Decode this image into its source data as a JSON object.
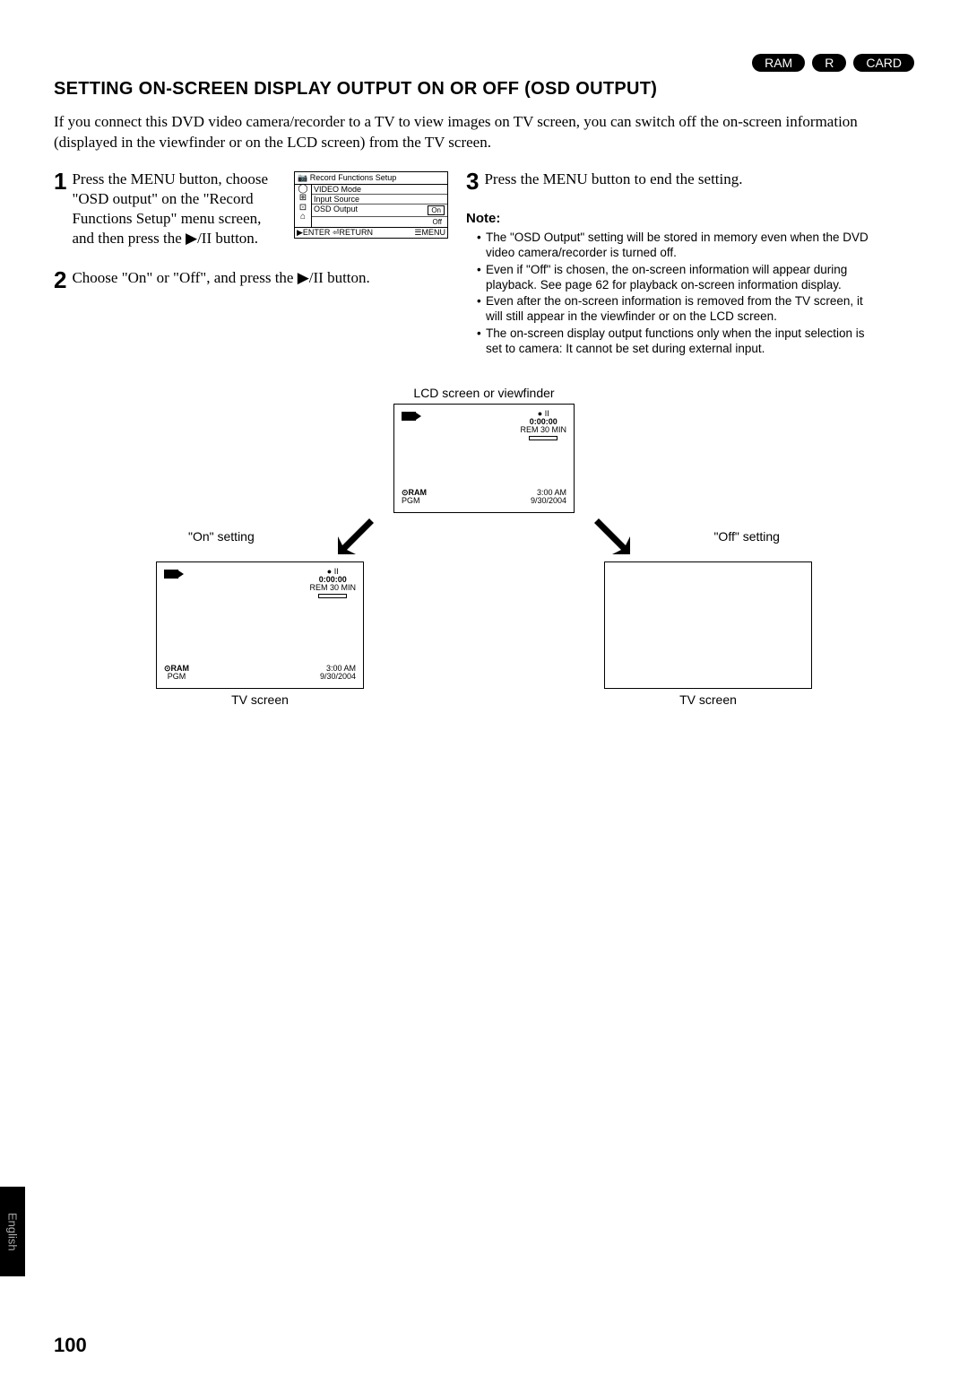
{
  "badges": [
    "RAM",
    "R",
    "CARD"
  ],
  "title": "SETTING ON-SCREEN DISPLAY OUTPUT ON OR OFF (OSD OUTPUT)",
  "intro": "If you connect this DVD video camera/recorder to a TV to view images on TV screen, you can switch off the on-screen information (displayed in the viewfinder or on the LCD screen) from the TV screen.",
  "steps": {
    "s1": {
      "num": "1",
      "text": "Press the MENU button, choose \"OSD output\" on the \"Record Functions Setup\" menu screen, and then press the ▶/II button."
    },
    "s2": {
      "num": "2",
      "text": "Choose \"On\" or \"Off\", and press the ▶/II button."
    },
    "s3": {
      "num": "3",
      "text": "Press the MENU button to end the setting."
    }
  },
  "menu": {
    "header": "Record Functions Setup",
    "rows": [
      "VIDEO Mode",
      "Input Source",
      "OSD Output"
    ],
    "opts": [
      "On",
      "Off"
    ],
    "footer_left": "ENTER",
    "footer_mid": "RETURN",
    "footer_right": "MENU"
  },
  "note_label": "Note:",
  "notes": [
    "The \"OSD Output\" setting will be stored in memory even when the DVD video camera/recorder is turned off.",
    "Even if \"Off\" is chosen, the on-screen information will appear during playback. See page 62 for playback on-screen information display.",
    "Even after the on-screen information is removed from the TV screen, it will still appear in the viewfinder or on the LCD screen.",
    "The on-screen display output functions only when the input selection is set to camera: It cannot be set during external input."
  ],
  "diagram": {
    "lcd_title": "LCD screen or viewfinder",
    "on_setting": "\"On\" setting",
    "off_setting": "\"Off\" setting",
    "tv_screen": "TV screen",
    "overlay": {
      "counter": "0:00:00",
      "remain": "REM 30 MIN",
      "disc_type": "RAM",
      "pgm": "PGM",
      "time": "3:00 AM",
      "date": "9/30/2004"
    }
  },
  "page_num": "100",
  "side_tab": "English"
}
